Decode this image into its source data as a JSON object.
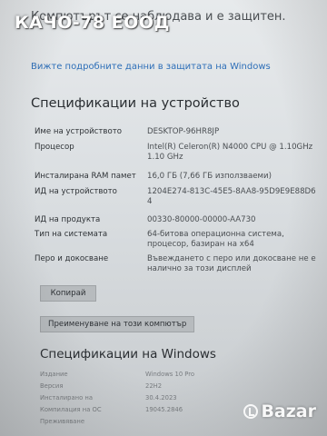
{
  "watermark": {
    "seller": "КАЧО-78 ЕООД",
    "site": "Bazar"
  },
  "protection": {
    "text": "Компютърът се наблюдава и е защитен.",
    "details_link": "Вижте подробните данни в защитата на Windows"
  },
  "device_specs": {
    "title": "Спецификации на устройство",
    "rows": [
      {
        "label": "Име на устройството",
        "value": "DESKTOP-96HR8JP"
      },
      {
        "label": "Процесор",
        "value": "Intel(R) Celeron(R) N4000 CPU @ 1.10GHz 1.10 GHz"
      },
      {
        "label": "Инсталирана RAM памет",
        "value": "16,0 ГБ (7,66 ГБ използваеми)"
      },
      {
        "label": "ИД на устройството",
        "value": "1204E274-813C-45E5-8AA8-95D9E9E88D64"
      },
      {
        "label": "ИД на продукта",
        "value": "00330-80000-00000-AA730"
      },
      {
        "label": "Тип на системата",
        "value": "64-битова операционна система, процесор, базиран на x64"
      },
      {
        "label": "Перо и докосване",
        "value": "Въвеждането с перо или докосване не е налично за този дисплей"
      }
    ],
    "copy_button": "Копирай",
    "rename_button": "Преименуване на този компютър"
  },
  "windows_specs": {
    "title": "Спецификации на Windows",
    "rows": [
      {
        "label": "Издание",
        "value": "Windows 10 Pro"
      },
      {
        "label": "Версия",
        "value": "22H2"
      },
      {
        "label": "Инсталирано на",
        "value": "30.4.2023"
      },
      {
        "label": "Компилация на ОС",
        "value": "19045.2846"
      },
      {
        "label": "Преживяване",
        "value": ""
      }
    ]
  }
}
